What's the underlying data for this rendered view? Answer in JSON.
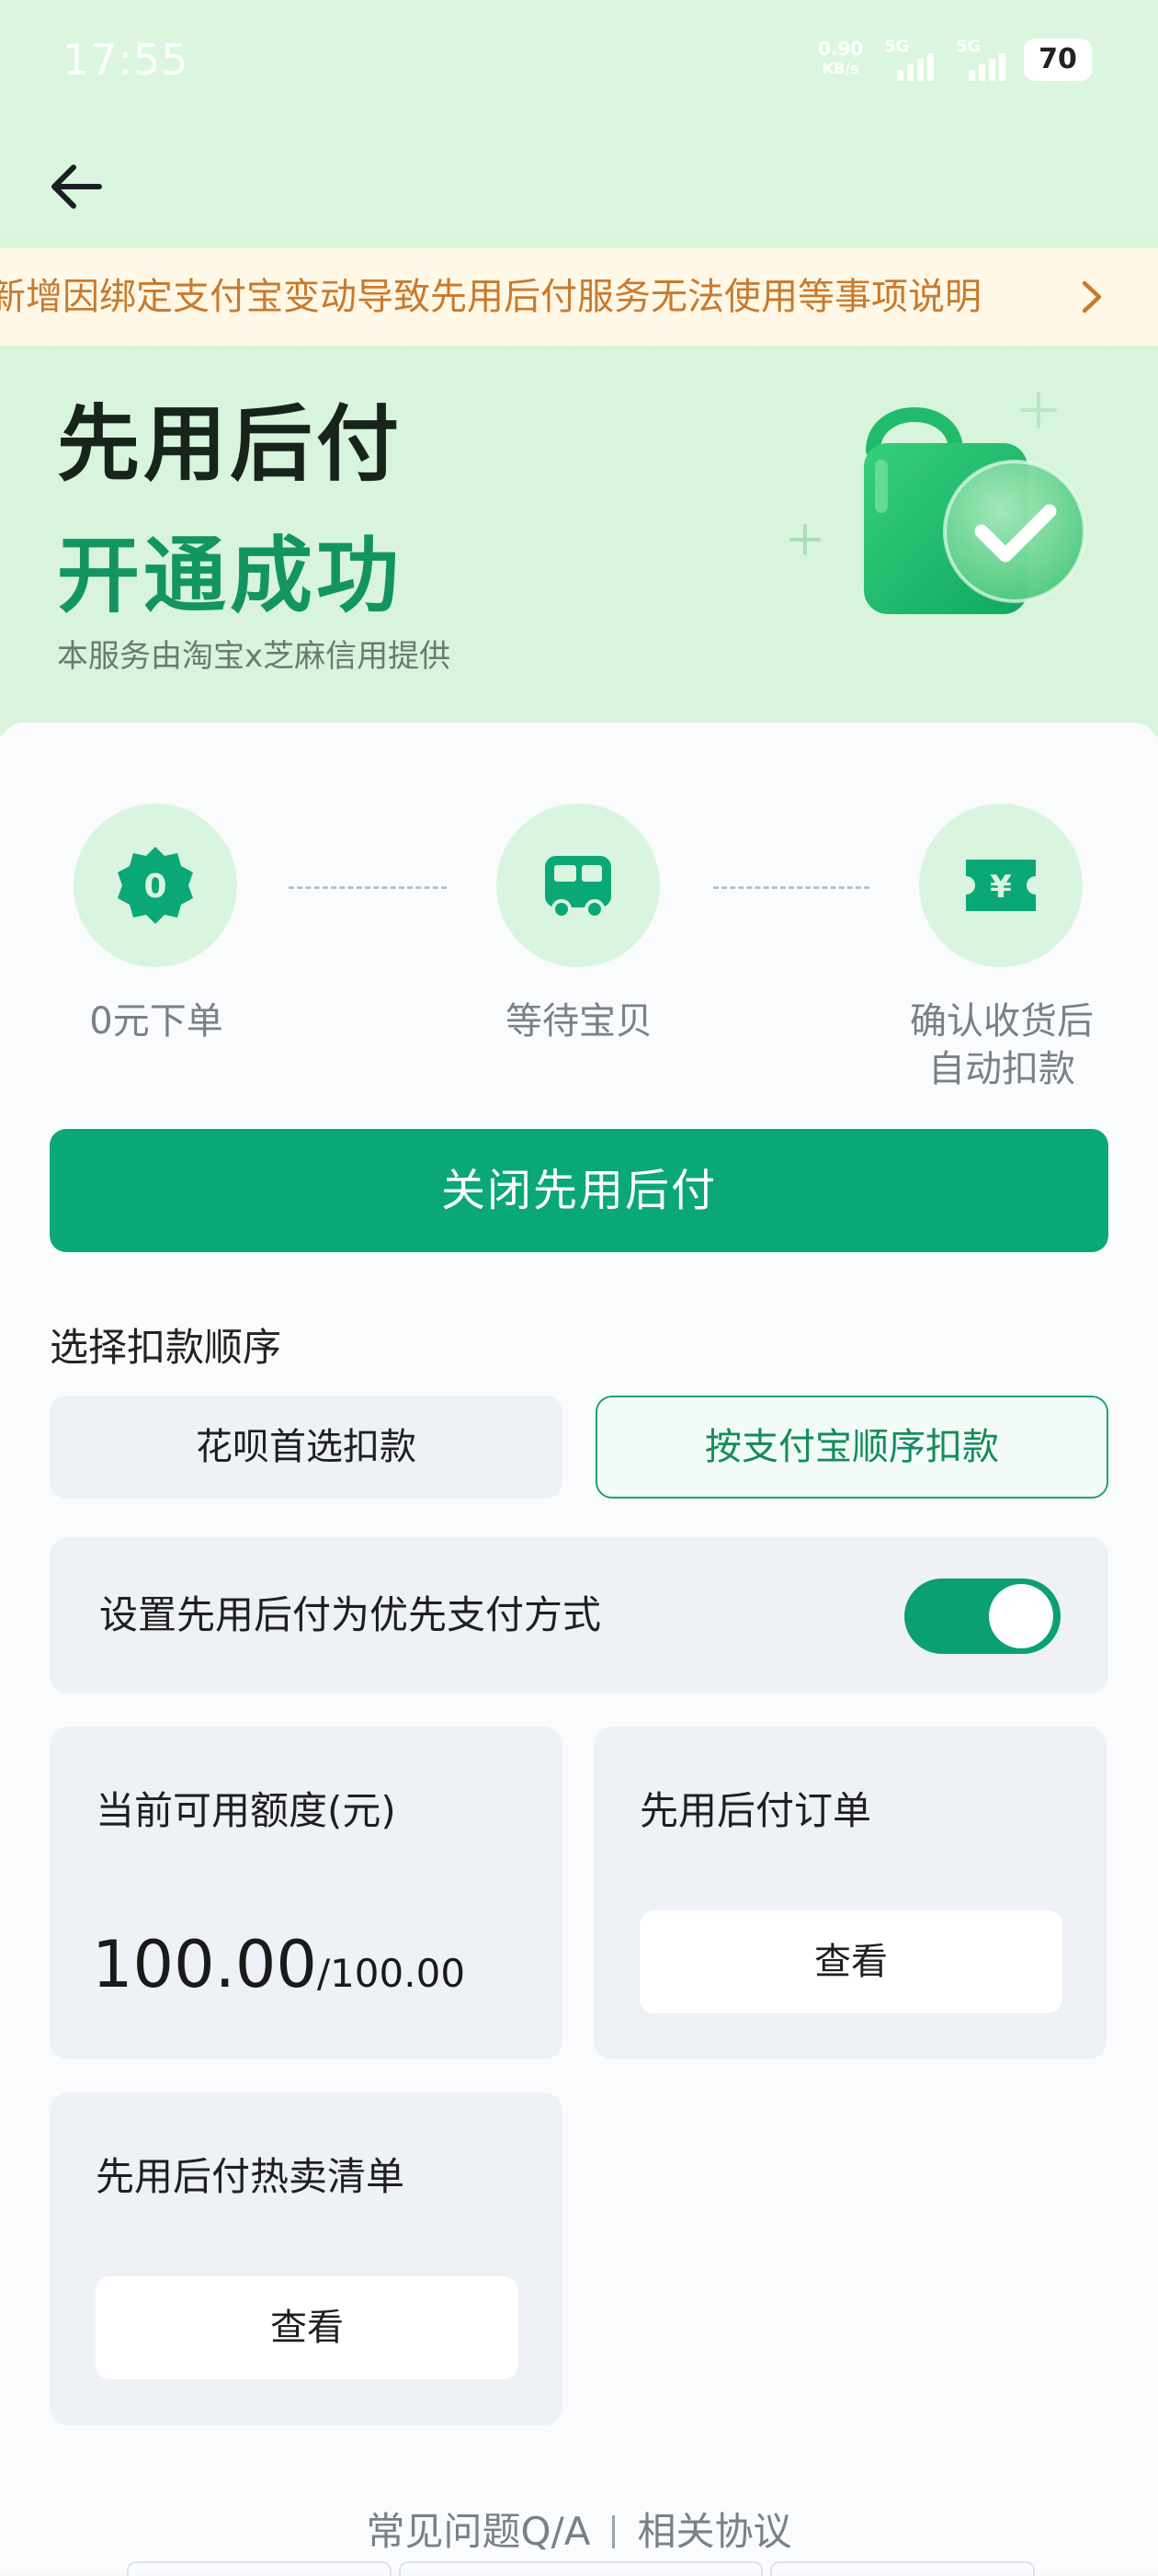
{
  "status": {
    "time": "17:55",
    "speed_value": "0.90",
    "speed_unit": "KB/s",
    "sim1_label": "5G",
    "sim2_label": "5G",
    "battery": "70"
  },
  "notice": {
    "text": "新增因绑定支付宝变动导致先用后付服务无法使用等事项说明"
  },
  "hero": {
    "title": "先用后付",
    "subtitle": "开通成功",
    "note": "本服务由淘宝x芝麻信用提供",
    "accent_color": "#139561"
  },
  "steps": [
    {
      "label": "0元下单",
      "icon": "zero-badge-icon",
      "badge_text": "0"
    },
    {
      "label": "等待宝贝",
      "icon": "delivery-truck-icon"
    },
    {
      "label_line1": "确认收货后",
      "label_line2": "自动扣款",
      "icon": "yuan-ticket-icon",
      "badge_text": "¥"
    }
  ],
  "primary_button": {
    "label": "关闭先用后付",
    "color": "#0ba877"
  },
  "deduction": {
    "section_label": "选择扣款顺序",
    "options": [
      {
        "label": "花呗首选扣款",
        "selected": false
      },
      {
        "label": "按支付宝顺序扣款",
        "selected": true
      }
    ]
  },
  "priority_setting": {
    "label": "设置先用后付为优先支付方式",
    "enabled": true
  },
  "tiles": {
    "quota": {
      "title": "当前可用额度(元)",
      "available": "100.00",
      "total": "/100.00"
    },
    "orders": {
      "title": "先用后付订单",
      "button": "查看"
    },
    "hot_list": {
      "title": "先用后付热卖清单",
      "button": "查看"
    }
  },
  "footer": {
    "faq": "常见问题Q/A",
    "agreements": "相关协议"
  }
}
